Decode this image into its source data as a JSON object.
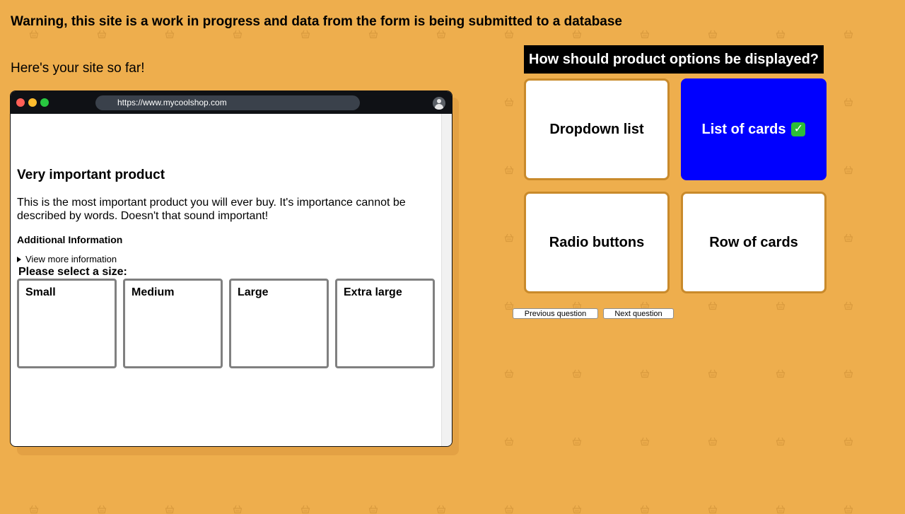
{
  "warning": "Warning, this site is a work in progress and data from the form is being submitted to a database",
  "intro": "Here's your site so far!",
  "browser": {
    "url": "https://www.mycoolshop.com",
    "product": {
      "title": "Very important product",
      "description": "This is the most important product you will ever buy. It's importance cannot be described by words. Doesn't that sound important!",
      "additional_info_heading": "Additional Information",
      "details_summary": "View more information",
      "size_prompt": "Please select a size:",
      "sizes": [
        "Small",
        "Medium",
        "Large",
        "Extra large"
      ]
    }
  },
  "quiz": {
    "question": "How should product options be displayed?",
    "options": [
      {
        "label": "Dropdown list",
        "selected": false
      },
      {
        "label": "List of cards",
        "selected": true
      },
      {
        "label": "Radio buttons",
        "selected": false
      },
      {
        "label": "Row of cards",
        "selected": false
      }
    ],
    "prev_label": "Previous question",
    "next_label": "Next question"
  },
  "colors": {
    "background": "#eeae4d",
    "selected_option": "#0000ff",
    "option_border": "#c98a2b",
    "question_bg": "#000000"
  },
  "icons": {
    "background_pattern": "basket-icon",
    "selected_mark": "check-mark-icon"
  }
}
